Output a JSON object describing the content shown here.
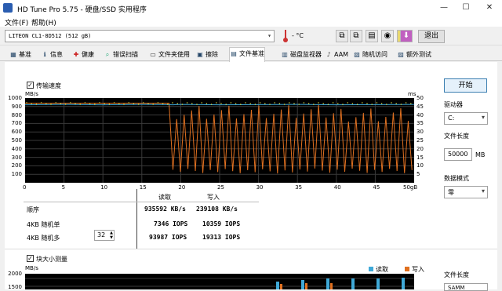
{
  "window": {
    "title": "HD Tune Pro 5.75 - 硬盘/SSD 实用程序",
    "min": "—",
    "max": "☐",
    "close": "✕"
  },
  "menu": {
    "file": "文件(F)",
    "help": "帮助(H)"
  },
  "toolbar": {
    "drive": "LITEON CL1-8D512 (512 gB)",
    "exit_label": "退出",
    "temp": "- °C"
  },
  "tabs": [
    {
      "label": "基准",
      "icon": "benchmark-icon"
    },
    {
      "label": "信息",
      "icon": "info-icon"
    },
    {
      "label": "健康",
      "icon": "health-icon"
    },
    {
      "label": "错误扫描",
      "icon": "scan-icon"
    },
    {
      "label": "文件夹使用",
      "icon": "folder-icon"
    },
    {
      "label": "擦除",
      "icon": "erase-icon"
    },
    {
      "label": "文件基准",
      "icon": "file-benchmark-icon"
    },
    {
      "label": "磁盘监视器",
      "icon": "monitor-icon"
    },
    {
      "label": "AAM",
      "icon": "speaker-icon"
    },
    {
      "label": "随机访问",
      "icon": "random-access-icon"
    },
    {
      "label": "额外测试",
      "icon": "extra-tests-icon"
    }
  ],
  "transfer": {
    "checkbox_label": "传输速度",
    "y_unit": "MB/s",
    "y2_unit": "ms",
    "y_ticks": [
      "1000",
      "900",
      "800",
      "700",
      "600",
      "500",
      "400",
      "300",
      "200",
      "100"
    ],
    "y2_ticks": [
      "50",
      "45",
      "40",
      "35",
      "30",
      "25",
      "20",
      "15",
      "10",
      "5"
    ],
    "x_ticks": [
      "0",
      "5",
      "10",
      "15",
      "20",
      "25",
      "30",
      "35",
      "40",
      "45",
      "50gB"
    ]
  },
  "results": {
    "col_read": "读取",
    "col_write": "写入",
    "rows": [
      {
        "label": "顺序",
        "read": "935592 KB/s",
        "write": "239108 KB/s"
      },
      {
        "label": "4KB 随机单",
        "read": "7346 IOPS",
        "write": "10359 IOPS"
      },
      {
        "label": "4KB 随机多",
        "read": "93987 IOPS",
        "write": "19313 IOPS"
      }
    ],
    "queue_depth": "32"
  },
  "block": {
    "checkbox_label": "块大小测量",
    "y_unit": "MB/s",
    "y_top": "2000",
    "y_next": "1500",
    "legend_read": "读取",
    "legend_write": "写入"
  },
  "side": {
    "start": "开始",
    "drive_letter_label": "驱动器",
    "drive_letter": "C:",
    "file_length_label": "文件长度",
    "file_length": "50000",
    "file_length_unit": "MB",
    "data_pattern_label": "数据模式",
    "data_pattern": "零",
    "file_length_label2": "文件长度",
    "file_length2": "SAMM"
  },
  "colors": {
    "read": "#3fa9d8",
    "write": "#e07020",
    "grid": "#3a3a3a",
    "chart_bg": "#000000"
  },
  "chart_data": {
    "type": "line",
    "xlabel": "",
    "ylabel": "MB/s",
    "xlim": [
      0,
      50
    ],
    "ylim": [
      0,
      1000
    ],
    "series": [
      {
        "name": "读取",
        "x": [
          0,
          5,
          10,
          15,
          18,
          19,
          20,
          25,
          30,
          35,
          40,
          45,
          50
        ],
        "values": [
          920,
          925,
          920,
          925,
          922,
          920,
          925,
          920,
          922,
          925,
          920,
          922,
          925
        ]
      },
      {
        "name": "写入",
        "x": [
          0,
          5,
          10,
          15,
          18.5,
          19,
          20,
          25,
          30,
          35,
          40,
          45,
          50
        ],
        "values": [
          940,
          940,
          940,
          940,
          940,
          120,
          760,
          150,
          820,
          130,
          780,
          140,
          800
        ]
      }
    ]
  }
}
